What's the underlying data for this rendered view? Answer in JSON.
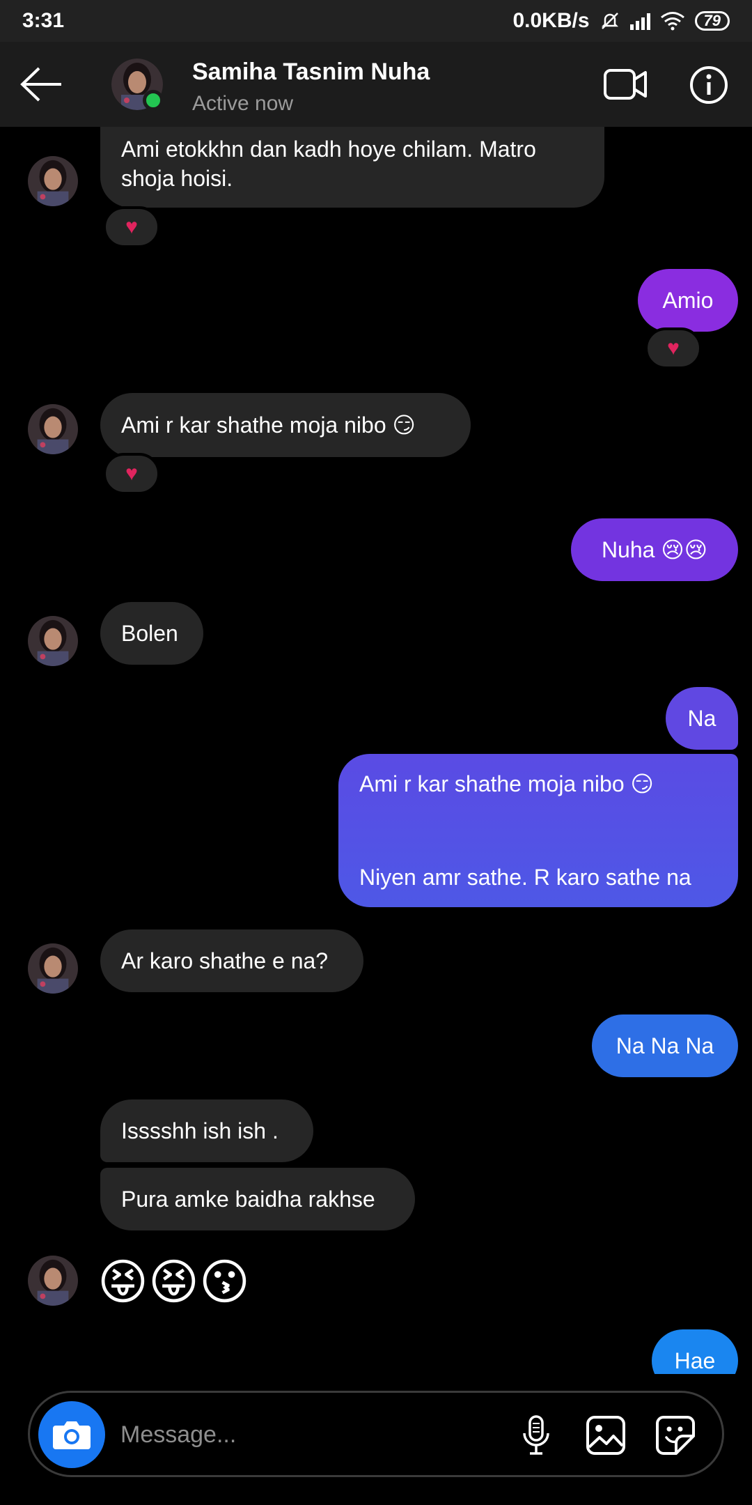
{
  "status_bar": {
    "time": "3:31",
    "network_speed": "0.0KB/s",
    "battery": "79"
  },
  "header": {
    "name": "Samiha Tasnim Nuha",
    "status": "Active now"
  },
  "messages": {
    "m1": "Ami etokkhn dan kadh hoye chilam. Matro",
    "m1b": "shoja hoisi.",
    "m2": "Amio",
    "m3": "Ami r kar shathe moja nibo 😏",
    "m4": "Nuha 😢😢",
    "m5": "Bolen",
    "m6": "Na",
    "m7a": "Ami r kar shathe moja nibo 😏",
    "m7b": "Niyen amr sathe. R karo sathe na",
    "m8": "Ar karo shathe e na?",
    "m9": "Na Na Na",
    "m10": "Isssshh ish ish .",
    "m11": "Pura amke baidha rakhse",
    "m12": "😝😝😗",
    "m13": "Hae"
  },
  "reactions": {
    "heart": "♥"
  },
  "colors": {
    "outgoing": [
      "#8e2de2",
      "#7b3ae0",
      "#6a48e2",
      "#5a55e6",
      "#2f6fe6",
      "#1a86f0"
    ],
    "incoming": "#262626",
    "accent": "#1877f2",
    "online": "#23c552"
  },
  "composer": {
    "placeholder": "Message..."
  },
  "icons": [
    "back-arrow-icon",
    "video-call-icon",
    "info-icon",
    "camera-icon",
    "microphone-icon",
    "gallery-icon",
    "sticker-icon",
    "heart-icon"
  ]
}
